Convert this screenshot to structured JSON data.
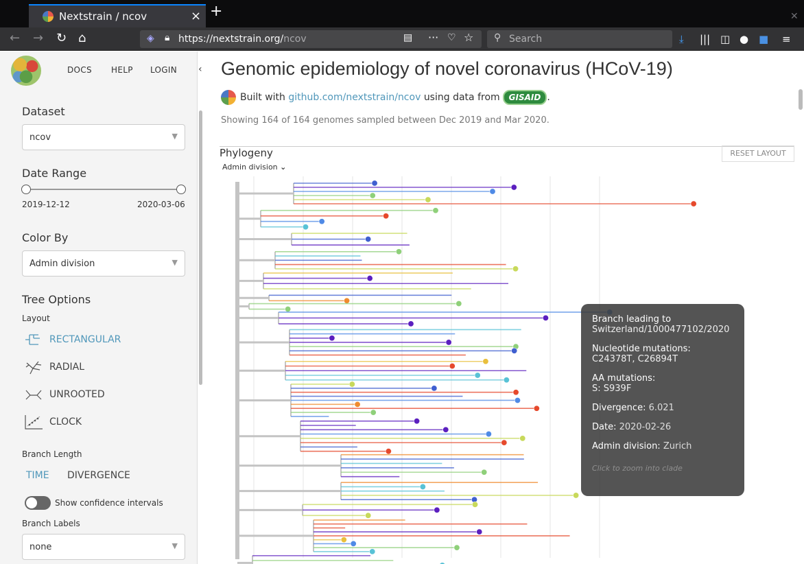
{
  "browser": {
    "tab_title": "Nextstrain / ncov",
    "url_host": "https://nextstrain.org/",
    "url_path": "ncov",
    "search_placeholder": "Search"
  },
  "nav": {
    "docs": "DOCS",
    "help": "HELP",
    "login": "LOGIN"
  },
  "sidebar": {
    "dataset_heading": "Dataset",
    "dataset_value": "ncov",
    "date_heading": "Date Range",
    "date_start": "2019-12-12",
    "date_end": "2020-03-06",
    "colorby_heading": "Color By",
    "colorby_value": "Admin division",
    "tree_heading": "Tree Options",
    "layout_label": "Layout",
    "layouts": [
      "RECTANGULAR",
      "RADIAL",
      "UNROOTED",
      "CLOCK"
    ],
    "branch_length_label": "Branch Length",
    "branch_time": "TIME",
    "branch_divergence": "DIVERGENCE",
    "confidence_label": "Show confidence intervals",
    "branch_labels_label": "Branch Labels",
    "branch_labels_value": "none"
  },
  "main": {
    "title": "Genomic epidemiology of novel coronavirus (HCoV-19)",
    "built_with": "Built with",
    "repo_link": "github.com/nextstrain/ncov",
    "using_data": "using data from",
    "gisaid": "GISAID",
    "period": ".",
    "showing": "Showing 164 of 164 genomes sampled between Dec 2019 and Mar 2020.",
    "phylogeny_title": "Phylogeny",
    "reset_layout": "RESET LAYOUT",
    "color_label": "Admin division"
  },
  "tooltip": {
    "branch_heading": "Branch leading to",
    "branch_name": "Switzerland/1000477102/2020",
    "nt_heading": "Nucleotide mutations:",
    "nt_value": "C24378T, C26894T",
    "aa_heading": "AA mutations:",
    "aa_value": "S: S939F",
    "divergence_key": "Divergence:",
    "divergence_value": "6.021",
    "date_key": "Date:",
    "date_value": "2020-02-26",
    "admin_key": "Admin division:",
    "admin_value": "Zurich",
    "hint": "Click to zoom into clade"
  },
  "colors": {
    "accent": "#5097ba",
    "tree_gray": "#c4c4c4",
    "palette": [
      "#5b1fbf",
      "#3f5fd0",
      "#4f8ae6",
      "#58c2d6",
      "#8fd07a",
      "#c8d95b",
      "#e9bf3c",
      "#ef8b2e",
      "#e6492c"
    ]
  }
}
